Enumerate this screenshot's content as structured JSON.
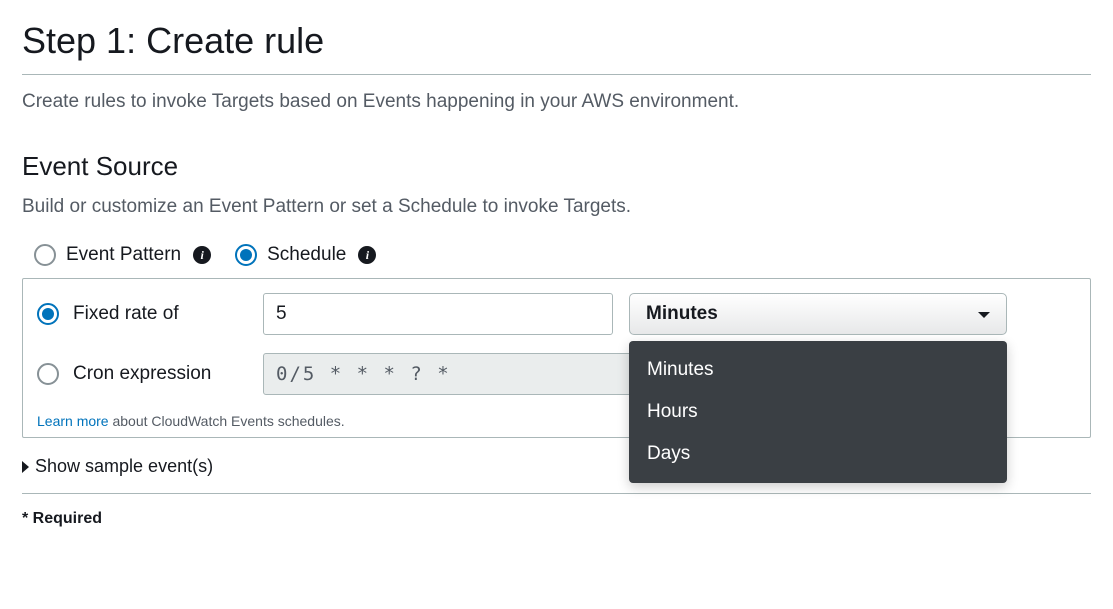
{
  "page": {
    "title": "Step 1: Create rule",
    "description": "Create rules to invoke Targets based on Events happening in your AWS environment."
  },
  "eventSource": {
    "title": "Event Source",
    "description": "Build or customize an Event Pattern or set a Schedule to invoke Targets.",
    "modes": {
      "eventPattern": {
        "label": "Event Pattern",
        "selected": false
      },
      "schedule": {
        "label": "Schedule",
        "selected": true
      }
    },
    "fixedRate": {
      "label": "Fixed rate of",
      "selected": true,
      "value": "5",
      "unit": {
        "selected": "Minutes",
        "options": [
          "Minutes",
          "Hours",
          "Days"
        ]
      }
    },
    "cron": {
      "label": "Cron expression",
      "selected": false,
      "value": "0/5 * * * ? *"
    },
    "learnMore": {
      "link": "Learn more",
      "text": " about CloudWatch Events schedules."
    }
  },
  "sampleEvents": {
    "label": "Show sample event(s)"
  },
  "footer": {
    "required": "* Required"
  }
}
